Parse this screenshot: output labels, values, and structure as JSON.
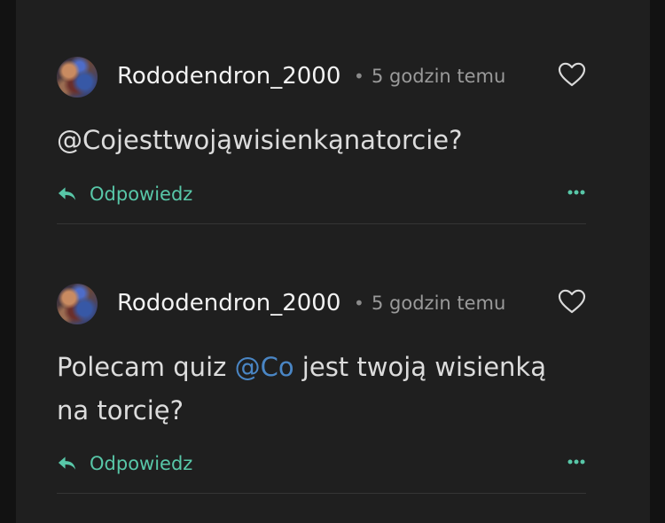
{
  "comments": [
    {
      "username": "Rododendron_2000",
      "separator": "•",
      "time": "5 godzin temu",
      "body": [
        {
          "text": "@Cojesttwojąwisienkąnatorcie?",
          "mention": false
        }
      ],
      "reply_label": "Odpowiedz"
    },
    {
      "username": "Rododendron_2000",
      "separator": "•",
      "time": "5 godzin temu",
      "body": [
        {
          "text": "Polecam quiz ",
          "mention": false
        },
        {
          "text": "@Co",
          "mention": true
        },
        {
          "text": " jest twoją wisienką na torcię?",
          "mention": false
        }
      ],
      "reply_label": "Odpowiedz"
    }
  ],
  "colors": {
    "background": "#121212",
    "panel": "#1f1f1f",
    "reply": "#58c7a8",
    "mention": "#4a86c5",
    "text": "#dcdcdc"
  },
  "icons": {
    "like": "heart-icon",
    "reply": "reply-arrow-icon",
    "more": "more-dots-icon"
  }
}
